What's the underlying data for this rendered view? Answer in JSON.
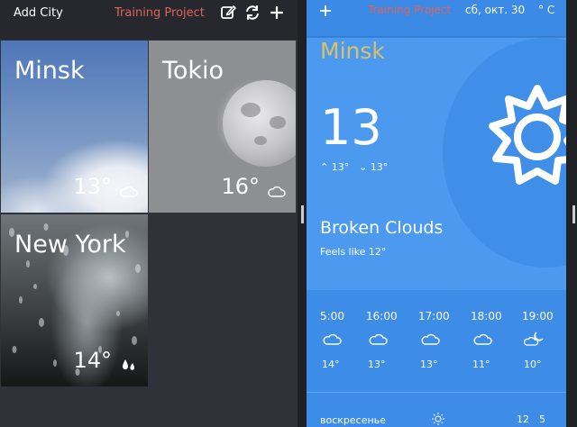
{
  "left_app": {
    "add_city_label": "Add City",
    "title": "Training Project",
    "toolbar_icons": [
      "edit-icon",
      "refresh-icon",
      "add-icon"
    ],
    "cities": [
      {
        "name": "Minsk",
        "temp": "13°",
        "icon": "cloud-icon"
      },
      {
        "name": "Tokio",
        "temp": "16°",
        "icon": "cloud-icon"
      },
      {
        "name": "New York",
        "temp": "14°",
        "icon": "rain-drops-icon"
      }
    ]
  },
  "right_app": {
    "title": "Training Project",
    "date": "сб, окт. 30",
    "unit": "° C",
    "city": "Minsk",
    "temperature": "13",
    "max_temp": "13°",
    "min_temp": "13°",
    "condition": "Broken Clouds",
    "feels_like": "Feels like 12°",
    "main_icon": "sun-icon",
    "hourly": [
      {
        "time": "5:00",
        "temp": "14°",
        "icon": "cloud-icon"
      },
      {
        "time": "16:00",
        "temp": "13°",
        "icon": "cloud-icon"
      },
      {
        "time": "17:00",
        "temp": "13°",
        "icon": "cloud-icon"
      },
      {
        "time": "18:00",
        "temp": "11°",
        "icon": "cloud-icon"
      },
      {
        "time": "19:00",
        "temp": "10°",
        "icon": "moon-cloud-icon"
      }
    ],
    "daily": [
      {
        "day": "воскресенье",
        "max": "12",
        "min": "5",
        "icon": "sun-icon"
      }
    ]
  },
  "colors": {
    "accent_title": "#e0635a",
    "city_name": "#d9c16a",
    "right_background": "#3d8ce8",
    "left_background": "#2f3238"
  }
}
